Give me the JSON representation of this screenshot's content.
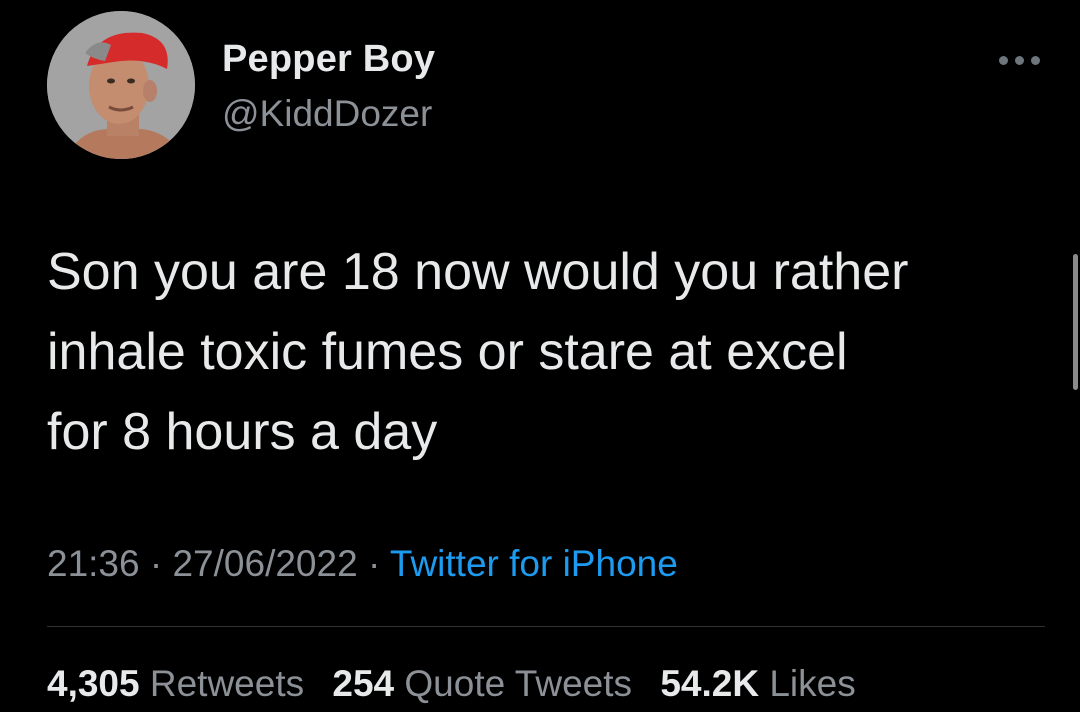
{
  "tweet": {
    "author": {
      "display_name": "Pepper Boy",
      "handle": "@KiddDozer",
      "avatar_icon": "profile-photo"
    },
    "more_icon": "more-options-icon",
    "text_lines": [
      "Son you are 18 now would you rather",
      "inhale toxic fumes or stare at excel",
      "for 8 hours a day"
    ],
    "time": "21:36",
    "date": "27/06/2022",
    "separator": " · ",
    "source": "Twitter for iPhone",
    "stats": {
      "retweets_count": "4,305",
      "retweets_label": "Retweets",
      "quotes_count": "254",
      "quotes_label": "Quote Tweets",
      "likes_count": "54.2K",
      "likes_label": "Likes"
    }
  },
  "colors": {
    "background": "#000000",
    "text": "#e7e9ea",
    "secondary": "#8b9196",
    "link": "#1d9bf0",
    "divider": "#2f3336"
  }
}
